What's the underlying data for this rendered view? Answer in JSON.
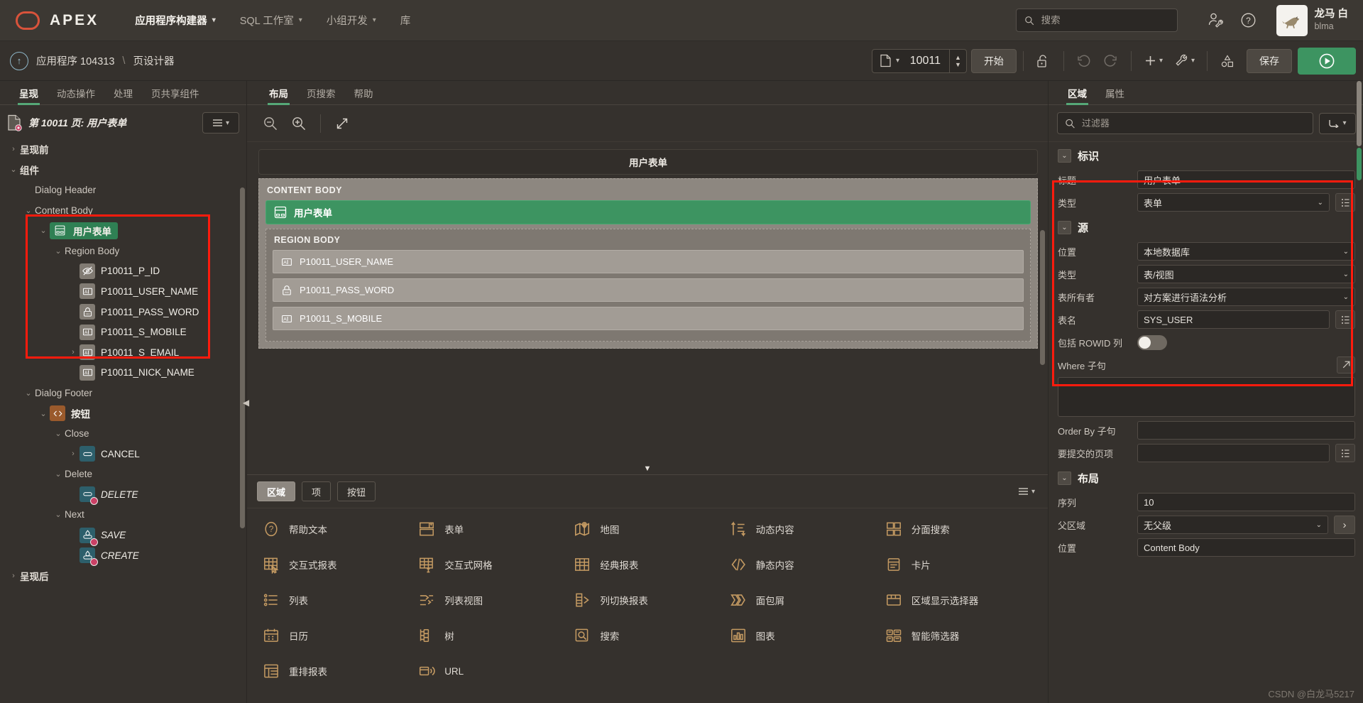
{
  "topnav": {
    "brand": "APEX",
    "items": [
      {
        "label": "应用程序构建器",
        "caret": true,
        "active": true
      },
      {
        "label": "SQL 工作室",
        "caret": true,
        "active": false
      },
      {
        "label": "小组开发",
        "caret": true,
        "active": false
      },
      {
        "label": "库",
        "caret": false,
        "active": false
      }
    ],
    "search_placeholder": "搜索",
    "icons": {
      "account": "user-wrench-icon",
      "help": "help-circle-icon"
    },
    "user": {
      "name": "龙马 白",
      "handle": "blma"
    }
  },
  "subbar": {
    "breadcrumb": {
      "app": "应用程序 104313",
      "sep": "\\",
      "page": "页设计器"
    },
    "page_number": "10011",
    "start_label": "开始",
    "save_label": "保存",
    "icons": [
      "lock-open-icon",
      "undo-icon",
      "redo-icon",
      "plus-icon",
      "wrench-icon",
      "shapes-icon",
      "run-play-icon"
    ]
  },
  "left": {
    "tabs": [
      {
        "label": "呈现",
        "active": true
      },
      {
        "label": "动态操作",
        "active": false
      },
      {
        "label": "处理",
        "active": false
      },
      {
        "label": "页共享组件",
        "active": false
      }
    ],
    "tree_title": "第 10011 页: 用户表单",
    "nodes": [
      {
        "label": "呈现前",
        "indent": 0,
        "tw": "right",
        "icon": null,
        "style": "bold"
      },
      {
        "label": "组件",
        "indent": 0,
        "tw": "down",
        "icon": null,
        "style": "bold"
      },
      {
        "label": "Dialog Header",
        "indent": 1,
        "tw": "none",
        "icon": null,
        "style": "plain"
      },
      {
        "label": "Content Body",
        "indent": 1,
        "tw": "down",
        "icon": null,
        "style": "plain"
      },
      {
        "label": "用户表单",
        "indent": 2,
        "tw": "down",
        "icon": "region-form-icon",
        "style": "selected"
      },
      {
        "label": "Region Body",
        "indent": 3,
        "tw": "down",
        "icon": null,
        "style": "plain"
      },
      {
        "label": "P10011_P_ID",
        "indent": 4,
        "tw": "none",
        "icon": "hidden-eye-icon",
        "style": "white"
      },
      {
        "label": "P10011_USER_NAME",
        "indent": 4,
        "tw": "none",
        "icon": "text-field-icon",
        "style": "white"
      },
      {
        "label": "P10011_PASS_WORD",
        "indent": 4,
        "tw": "none",
        "icon": "password-lock-icon",
        "style": "white"
      },
      {
        "label": "P10011_S_MOBILE",
        "indent": 4,
        "tw": "none",
        "icon": "text-field-icon",
        "style": "white"
      },
      {
        "label": "P10011_S_EMAIL",
        "indent": 4,
        "tw": "right",
        "icon": "text-field-icon",
        "style": "white"
      },
      {
        "label": "P10011_NICK_NAME",
        "indent": 4,
        "tw": "none",
        "icon": "text-field-icon",
        "style": "white"
      },
      {
        "label": "Dialog Footer",
        "indent": 1,
        "tw": "down",
        "icon": null,
        "style": "plain"
      },
      {
        "label": "按钮",
        "indent": 2,
        "tw": "down",
        "icon": "code-icon",
        "style": "boldwhite"
      },
      {
        "label": "Close",
        "indent": 3,
        "tw": "down",
        "icon": null,
        "style": "plain"
      },
      {
        "label": "CANCEL",
        "indent": 4,
        "tw": "right",
        "icon": "button-icon",
        "style": "white"
      },
      {
        "label": "Delete",
        "indent": 3,
        "tw": "down",
        "icon": null,
        "style": "plain"
      },
      {
        "label": "DELETE",
        "indent": 4,
        "tw": "none",
        "icon": "button-cond-icon",
        "style": "ital"
      },
      {
        "label": "Next",
        "indent": 3,
        "tw": "down",
        "icon": null,
        "style": "plain"
      },
      {
        "label": "SAVE",
        "indent": 4,
        "tw": "none",
        "icon": "button-hot-icon",
        "style": "ital"
      },
      {
        "label": "CREATE",
        "indent": 4,
        "tw": "none",
        "icon": "button-hot-icon",
        "style": "ital"
      },
      {
        "label": "呈现后",
        "indent": 0,
        "tw": "right",
        "icon": null,
        "style": "bold"
      }
    ]
  },
  "center": {
    "tabs": [
      {
        "label": "布局",
        "active": true
      },
      {
        "label": "页搜索",
        "active": false
      },
      {
        "label": "帮助",
        "active": false
      }
    ],
    "toolbar_icons": [
      "zoom-out-icon",
      "zoom-in-icon",
      "expand-icon"
    ],
    "dialog_header_title": "用户表单",
    "content_body_label": "CONTENT BODY",
    "selected_region_title": "用户表单",
    "region_body_label": "REGION BODY",
    "items": [
      {
        "name": "P10011_USER_NAME",
        "icon": "text-field-icon"
      },
      {
        "name": "P10011_PASS_WORD",
        "icon": "password-lock-icon"
      },
      {
        "name": "P10011_S_MOBILE",
        "icon": "text-field-icon"
      }
    ],
    "gallery_tabs": [
      {
        "label": "区域",
        "active": true
      },
      {
        "label": "项",
        "active": false
      },
      {
        "label": "按钮",
        "active": false
      }
    ],
    "gallery": [
      {
        "label": "帮助文本",
        "icon": "help-text-icon"
      },
      {
        "label": "表单",
        "icon": "form-icon"
      },
      {
        "label": "地图",
        "icon": "map-icon"
      },
      {
        "label": "动态内容",
        "icon": "dynamic-content-icon"
      },
      {
        "label": "分面搜索",
        "icon": "faceted-search-icon"
      },
      {
        "label": "交互式报表",
        "icon": "interactive-report-icon"
      },
      {
        "label": "交互式网格",
        "icon": "interactive-grid-icon"
      },
      {
        "label": "经典报表",
        "icon": "classic-report-icon"
      },
      {
        "label": "静态内容",
        "icon": "static-content-icon"
      },
      {
        "label": "卡片",
        "icon": "cards-icon"
      },
      {
        "label": "列表",
        "icon": "list-icon"
      },
      {
        "label": "列表视图",
        "icon": "list-view-icon"
      },
      {
        "label": "列切换报表",
        "icon": "column-toggle-icon"
      },
      {
        "label": "面包屑",
        "icon": "breadcrumb-icon"
      },
      {
        "label": "区域显示选择器",
        "icon": "region-display-selector-icon"
      },
      {
        "label": "日历",
        "icon": "calendar-icon"
      },
      {
        "label": "树",
        "icon": "tree-icon"
      },
      {
        "label": "搜索",
        "icon": "search-region-icon"
      },
      {
        "label": "图表",
        "icon": "chart-icon"
      },
      {
        "label": "智能筛选器",
        "icon": "smart-filter-icon"
      },
      {
        "label": "重排报表",
        "icon": "reflow-report-icon"
      },
      {
        "label": "URL",
        "icon": "url-icon"
      }
    ]
  },
  "right": {
    "tabs": [
      {
        "label": "区域",
        "active": true
      },
      {
        "label": "属性",
        "active": false
      }
    ],
    "filter_placeholder": "过滤器",
    "sections": [
      {
        "title": "标识",
        "rows": [
          {
            "label": "标题",
            "value": "用户表单",
            "kind": "text"
          },
          {
            "label": "类型",
            "value": "表单",
            "kind": "select-lov"
          }
        ]
      },
      {
        "title": "源",
        "rows": [
          {
            "label": "位置",
            "value": "本地数据库",
            "kind": "select"
          },
          {
            "label": "类型",
            "value": "表/视图",
            "kind": "select"
          },
          {
            "label": "表所有者",
            "value": "对方案进行语法分析",
            "kind": "select"
          },
          {
            "label": "表名",
            "value": "SYS_USER",
            "kind": "text-lov"
          },
          {
            "label": "包括 ROWID 列",
            "value": "",
            "kind": "toggle"
          },
          {
            "label": "Where 子句",
            "value": "",
            "kind": "textarea"
          },
          {
            "label": "Order By 子句",
            "value": "",
            "kind": "text"
          },
          {
            "label": "要提交的页项",
            "value": "",
            "kind": "text-lov"
          }
        ]
      },
      {
        "title": "布局",
        "rows": [
          {
            "label": "序列",
            "value": "10",
            "kind": "text"
          },
          {
            "label": "父区域",
            "value": "无父级",
            "kind": "select-arrow"
          },
          {
            "label": "位置",
            "value": "Content Body",
            "kind": "text"
          }
        ]
      }
    ],
    "watermark": "CSDN @白龙马5217"
  }
}
